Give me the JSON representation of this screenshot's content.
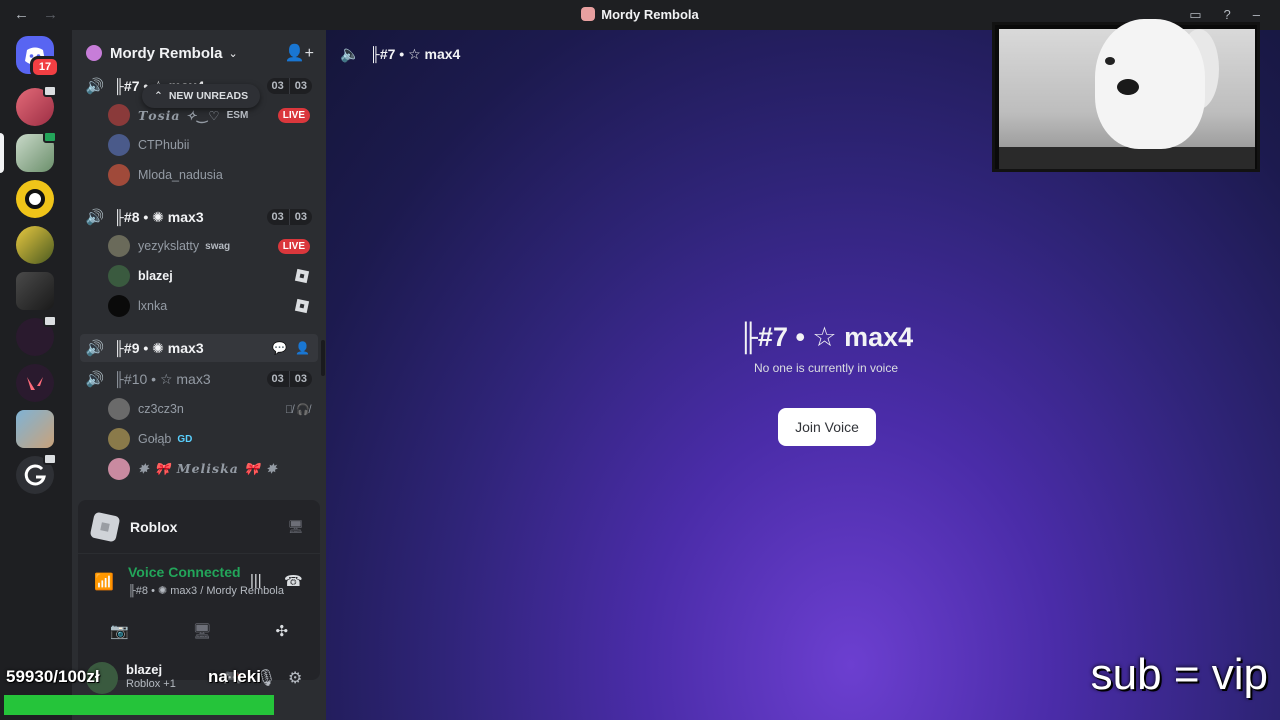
{
  "window": {
    "title": "Mordy Rembola",
    "back": "←",
    "forward": "→",
    "inbox_icon": "▭",
    "help_icon": "?",
    "minimize_icon": "–"
  },
  "rail": {
    "dm_badge": "17",
    "dm_icon": "discord-logo"
  },
  "guild": {
    "name": "Mordy Rembola",
    "chevron": "⌄",
    "invite_icon": "👤+"
  },
  "new_unreads": "NEW UNREADS",
  "voice_channels": [
    {
      "name": "╟#7 • ☆ max4",
      "count_a": "03",
      "count_b": "03",
      "members": [
        {
          "name": "𝑻𝒐𝒔𝒊𝒂 ✧‿♡",
          "tag": "ESM",
          "live": "LIVE"
        },
        {
          "name": "CTPhubii"
        },
        {
          "name": "Mloda_nadusia"
        }
      ]
    },
    {
      "name": "╟#8 • ✺ max3",
      "count_a": "03",
      "count_b": "03",
      "members": [
        {
          "name": "yezykslatty",
          "tag": "swag",
          "live": "LIVE"
        },
        {
          "name": "blazej"
        },
        {
          "name": "lxnka"
        }
      ]
    },
    {
      "name": "╟#9 • ✺ max3"
    },
    {
      "name": "╟#10 • ☆ max3",
      "count_a": "03",
      "count_b": "03",
      "members": [
        {
          "name": "cz3cz3n"
        },
        {
          "name": "Gołąb",
          "tag": "GD"
        },
        {
          "name": "✸ 🎀 𝑴𝒆𝒍𝒊𝒔𝒌𝒂 🎀 ✸"
        }
      ]
    }
  ],
  "activity": {
    "name": "Roblox"
  },
  "voice": {
    "status": "Voice Connected",
    "location": "╟#8 • ✺ max3 / Mordy Rembola"
  },
  "user": {
    "name": "blazej",
    "status": "Roblox +1"
  },
  "overlay": {
    "counter": "59930/100zł",
    "naleki": "na leki",
    "progress_fraction": 0.59,
    "subvip": "sub = vip"
  },
  "main": {
    "header_name": "╟#7 • ☆ max4",
    "title": "╟#7 • ☆ max4",
    "subtitle": "No one is currently in voice",
    "join_label": "Join Voice"
  },
  "colors": {
    "voice_green": "#23a55a",
    "live_red": "#da373c",
    "progress_green": "#25c43a"
  }
}
